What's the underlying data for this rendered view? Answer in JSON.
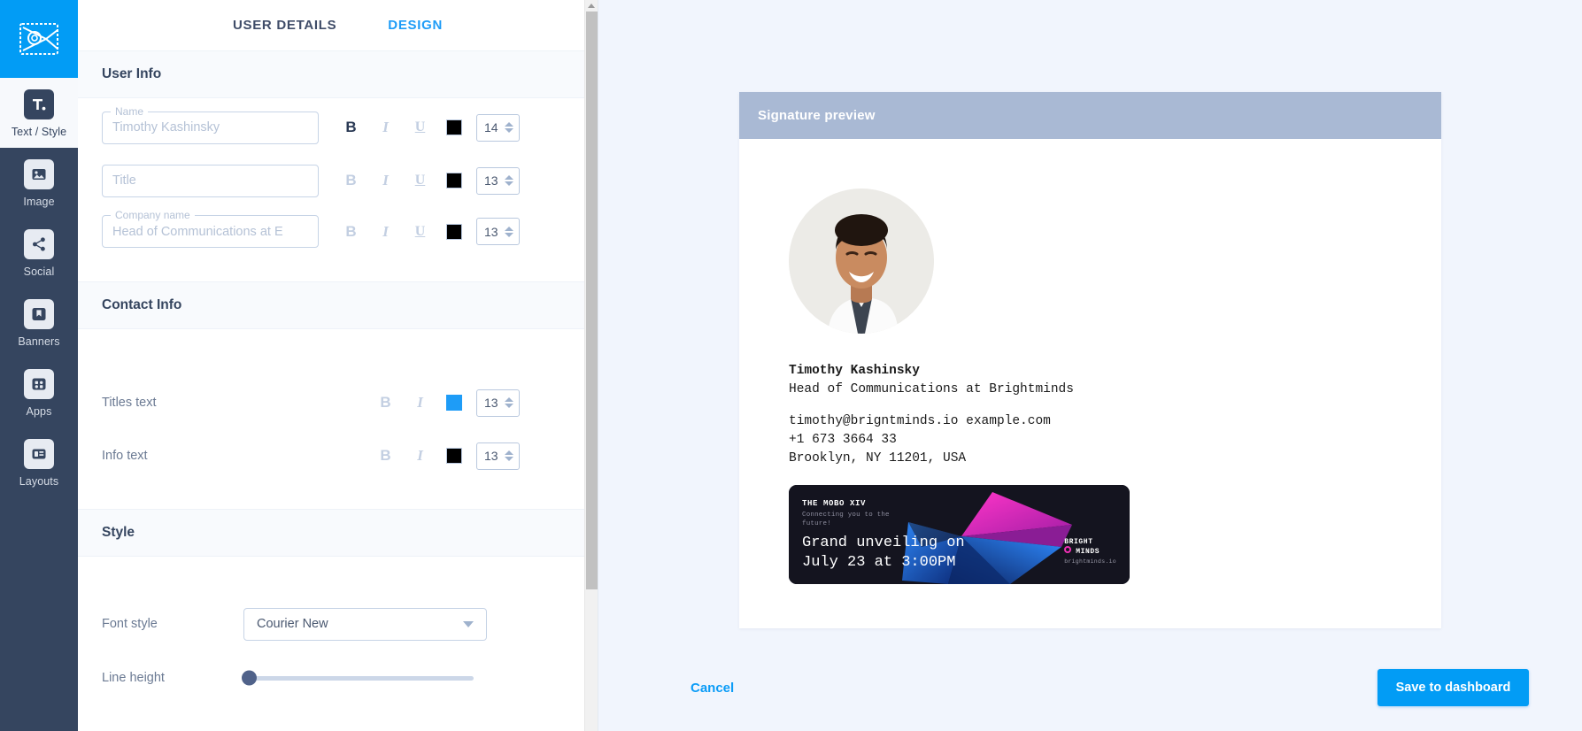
{
  "rail": {
    "logo_icon": "envelope-at-logo",
    "items": [
      {
        "label": "Text / Style",
        "icon": "text-style-icon",
        "active": true
      },
      {
        "label": "Image",
        "icon": "image-icon",
        "active": false
      },
      {
        "label": "Social",
        "icon": "share-icon",
        "active": false
      },
      {
        "label": "Banners",
        "icon": "bookmark-icon",
        "active": false
      },
      {
        "label": "Apps",
        "icon": "grid-apps-icon",
        "active": false
      },
      {
        "label": "Layouts",
        "icon": "layouts-icon",
        "active": false
      }
    ]
  },
  "tabs": [
    {
      "label": "USER DETAILS",
      "active": false
    },
    {
      "label": "DESIGN",
      "active": true
    }
  ],
  "sections": {
    "user_info": {
      "title": "User Info",
      "rows": [
        {
          "notch": "Name",
          "value": "Timothy Kashinsky",
          "bold": "B",
          "bold_on": true,
          "italic": "I",
          "underline": "U",
          "color": "#000000",
          "size": "14"
        },
        {
          "notch": "",
          "value": "Title",
          "bold": "B",
          "bold_on": false,
          "italic": "I",
          "underline": "U",
          "color": "#000000",
          "size": "13"
        },
        {
          "notch": "Company name",
          "value": "Head of Communications at E",
          "bold": "B",
          "bold_on": false,
          "italic": "I",
          "underline": "U",
          "color": "#000000",
          "size": "13"
        }
      ]
    },
    "contact_info": {
      "title": "Contact Info",
      "rows": [
        {
          "label": "Titles text",
          "bold": "B",
          "italic": "I",
          "color": "#1e9cf7",
          "size": "13"
        },
        {
          "label": "Info text",
          "bold": "B",
          "italic": "I",
          "color": "#000000",
          "size": "13"
        }
      ]
    },
    "style": {
      "title": "Style",
      "font_style_label": "Font style",
      "font_style_value": "Courier New",
      "line_height_label": "Line height",
      "line_height_pct": 0
    }
  },
  "preview": {
    "header": "Signature preview",
    "avatar_alt": "user-photo",
    "name": "Timothy Kashinsky",
    "title": "Head of Communications at Brightminds",
    "contact": [
      "timothy@brigntminds.io example.com",
      "+1 673 3664 33",
      "Brooklyn, NY 11201, USA"
    ],
    "banner": {
      "kicker": "THE MOBO XIV",
      "subtitle": "Connecting you to the future!",
      "headline": "Grand unveiling on\nJuly 23 at 3:00PM",
      "brand_line1": "BRIGHT",
      "brand_line2": "MINDS",
      "brand_url": "brightminds.io",
      "bg": "#14141f",
      "accent_pink": "#ee2fb4",
      "accent_blue": "#1f6ef5"
    }
  },
  "actions": {
    "cancel": "Cancel",
    "save": "Save to dashboard"
  }
}
